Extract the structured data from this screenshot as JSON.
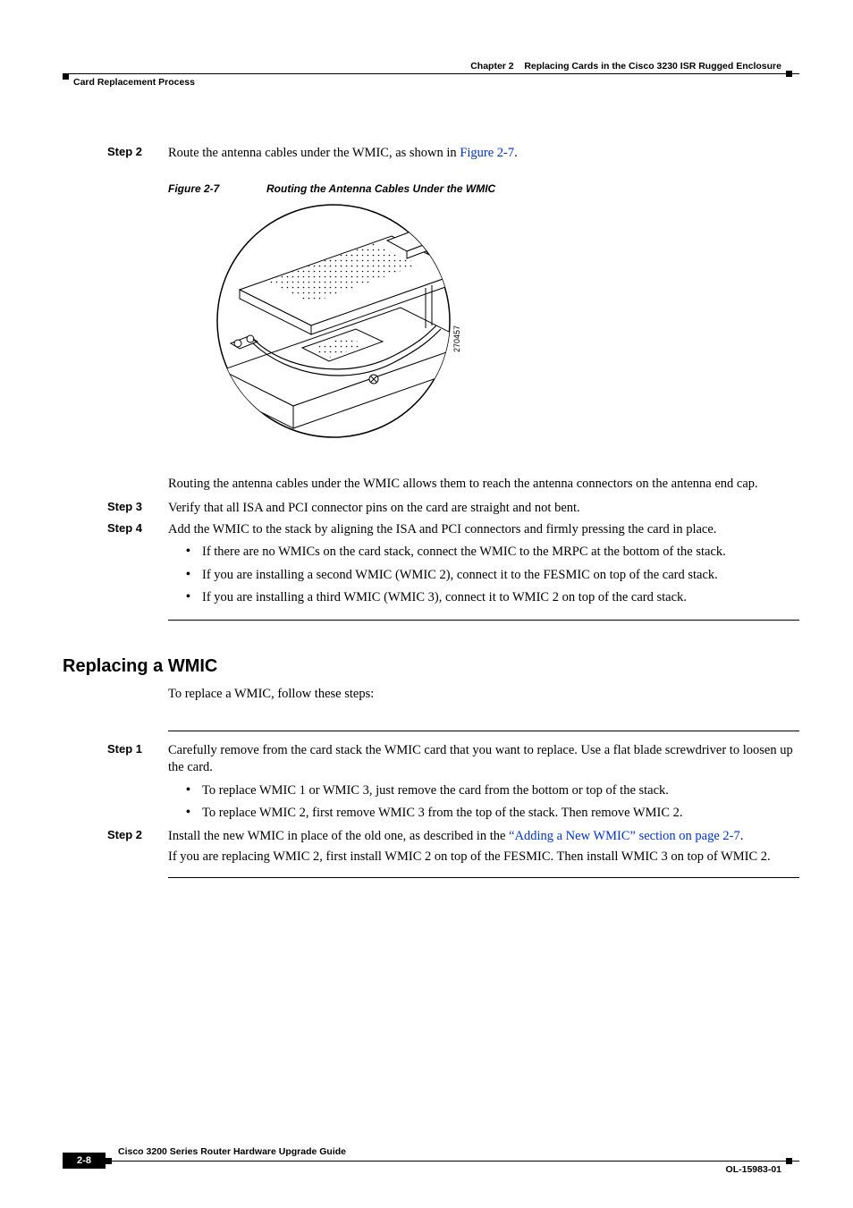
{
  "header": {
    "chapter_label": "Chapter 2",
    "chapter_title": "Replacing Cards in the Cisco 3230 ISR Rugged Enclosure",
    "section_title": "Card Replacement Process"
  },
  "steps_a": [
    {
      "label": "Step 2",
      "text_pre": "Route the antenna cables under the WMIC, as shown in ",
      "link": "Figure 2-7",
      "text_post": "."
    }
  ],
  "figure": {
    "number": "Figure 2-7",
    "title": "Routing the Antenna Cables Under the WMIC",
    "id_label": "270457"
  },
  "para_routing": "Routing the antenna cables under the WMIC allows them to reach the antenna connectors on the antenna end cap.",
  "steps_b": [
    {
      "label": "Step 3",
      "text": "Verify that all ISA and PCI connector pins on the card are straight and not bent."
    },
    {
      "label": "Step 4",
      "text": "Add the WMIC to the stack by aligning the ISA and PCI connectors and firmly pressing the card in place."
    }
  ],
  "bullets_a": [
    "If there are no WMICs on the card stack, connect the WMIC to the MRPC at the bottom of the stack.",
    "If you are installing a second WMIC (WMIC 2), connect it to the FESMIC on top of the card stack.",
    "If you are installing a third WMIC (WMIC 3), connect it to WMIC 2 on top of the card stack."
  ],
  "h2": "Replacing a WMIC",
  "para_replace_intro": "To replace a WMIC, follow these steps:",
  "steps_c": [
    {
      "label": "Step 1",
      "text": "Carefully remove from the card stack the WMIC card that you want to replace. Use a flat blade screwdriver to loosen up the card."
    }
  ],
  "bullets_b": [
    "To replace WMIC 1 or WMIC 3, just remove the card from the bottom or top of the stack.",
    "To replace WMIC 2, first remove WMIC 3 from the top of the stack. Then remove WMIC 2."
  ],
  "step_c2": {
    "label": "Step 2",
    "text_pre": "Install the new WMIC in place of the old one, as described in the ",
    "link": "“Adding a New WMIC” section on page 2-7",
    "text_post": "."
  },
  "para_replace_note": "If you are replacing WMIC 2, first install WMIC 2 on top of the FESMIC. Then install WMIC 3 on top of WMIC 2.",
  "footer": {
    "book_title": "Cisco 3200 Series Router Hardware Upgrade Guide",
    "page_number": "2-8",
    "doc_number": "OL-15983-01"
  }
}
